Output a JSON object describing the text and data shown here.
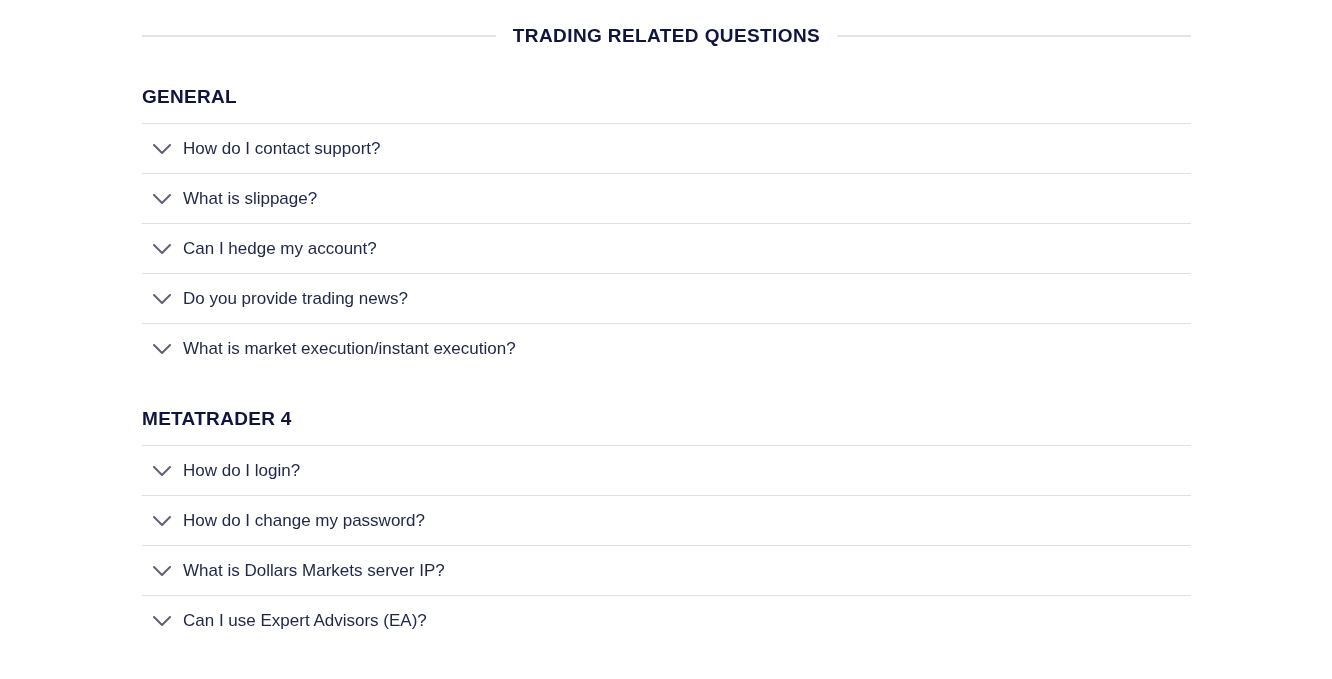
{
  "page_title": "TRADING RELATED QUESTIONS",
  "sections": [
    {
      "heading": "GENERAL",
      "questions": [
        {
          "text": "How do I contact support?",
          "expanded": false
        },
        {
          "text": "What is slippage?",
          "expanded": false
        },
        {
          "text": "Can I hedge my account?",
          "expanded": false
        },
        {
          "text": "Do you provide trading news?",
          "expanded": false
        },
        {
          "text": "What is market execution/instant execution?",
          "expanded": false
        }
      ]
    },
    {
      "heading": "METATRADER 4",
      "questions": [
        {
          "text": "How do I login?",
          "expanded": false
        },
        {
          "text": "How do I change my password?",
          "expanded": false
        },
        {
          "text": "What is Dollars Markets server IP?",
          "expanded": false
        },
        {
          "text": "Can I use Expert Advisors (EA)?",
          "expanded": false
        }
      ]
    }
  ]
}
